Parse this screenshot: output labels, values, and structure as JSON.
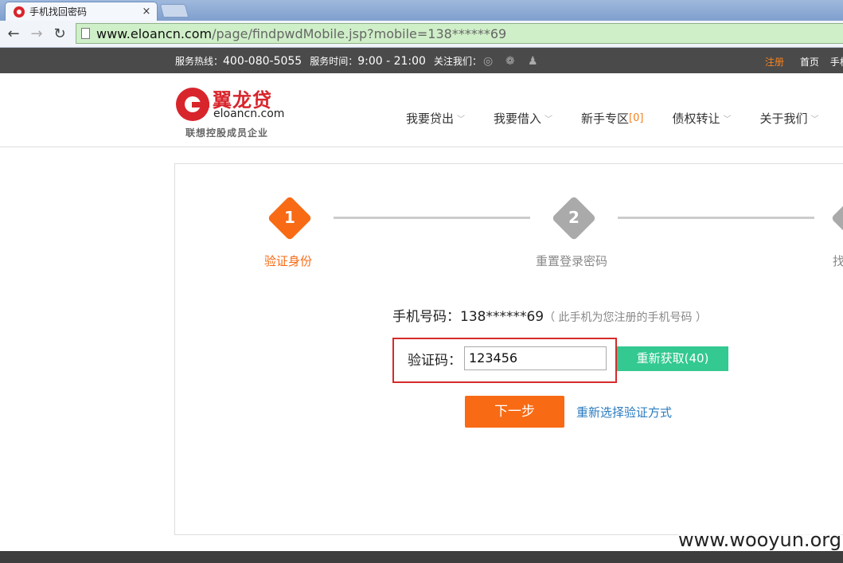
{
  "browser": {
    "tab_title": "手机找回密码",
    "tab_close": "×",
    "url_host": "www.eloancn.com",
    "url_path": "/page/findpwdMobile.jsp?mobile=138******69",
    "back_icon": "←",
    "forward_icon": "→",
    "reload_icon": "↻"
  },
  "topbar": {
    "hotline_label": "服务热线：",
    "hotline_number": "400-080-5055",
    "hours_label": "服务时间：",
    "hours_value": "9:00 - 21:00",
    "follow_label": "关注我们：",
    "register": "注册",
    "home": "首页",
    "mobile": "手机",
    "accent_color": "#f58220"
  },
  "header": {
    "brand_cn": "翼龙贷",
    "brand_en": "eloancn.com",
    "slogan": "联想控股成员企业",
    "nav": [
      {
        "label": "我要贷出",
        "chevron": "﹀"
      },
      {
        "label": "我要借入",
        "chevron": "﹀"
      },
      {
        "label": "新手专区",
        "badge": "[0]"
      },
      {
        "label": "债权转让",
        "chevron": "﹀"
      },
      {
        "label": "关于我们",
        "chevron": "﹀"
      }
    ]
  },
  "steps": [
    {
      "num": "1",
      "label": "验证身份",
      "active": true,
      "color": "#f86a14"
    },
    {
      "num": "2",
      "label": "重置登录密码",
      "active": false,
      "color": "#aaaaaa"
    },
    {
      "num": "",
      "label": "找",
      "active": false,
      "color": "#aaaaaa"
    }
  ],
  "form": {
    "phone_label": "手机号码：",
    "phone_value": "138******69",
    "phone_note": "（ 此手机为您注册的手机号码 ）",
    "code_label": "验证码：",
    "code_value": "123456",
    "resend_label": "重新获取(40)",
    "next_label": "下一步",
    "reselect_link": "重新选择验证方式"
  },
  "watermark": "www.wooyun.org"
}
